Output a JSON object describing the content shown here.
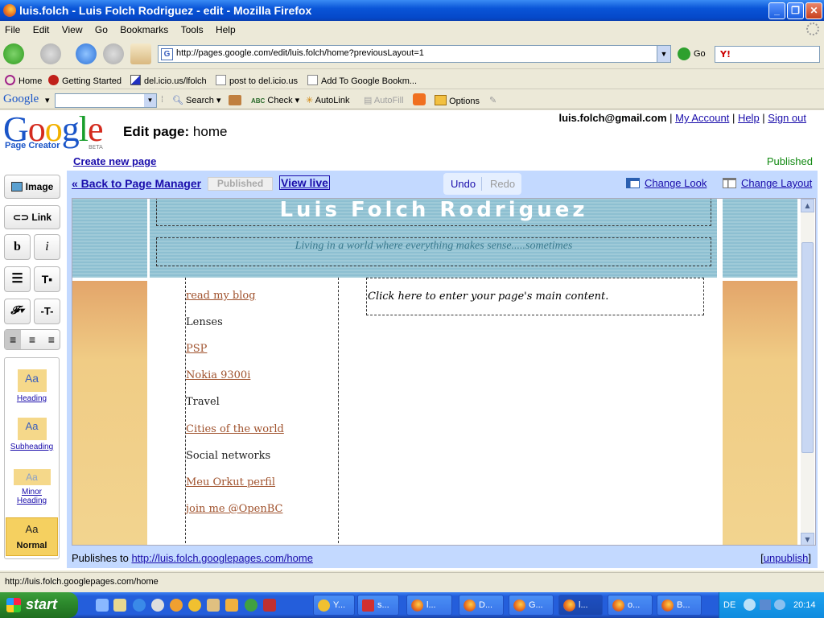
{
  "window": {
    "title": "luis.folch - Luis Folch Rodriguez - edit - Mozilla Firefox"
  },
  "menu": [
    "File",
    "Edit",
    "View",
    "Go",
    "Bookmarks",
    "Tools",
    "Help"
  ],
  "nav": {
    "url": "http://pages.google.com/edit/luis.folch/home?previousLayout=1",
    "go_label": "Go"
  },
  "bookmarks": [
    "Home",
    "Getting Started",
    "del.icio.us/lfolch",
    "post to del.icio.us",
    "Add To Google Bookm..."
  ],
  "gtoolbar": {
    "logo": "Google",
    "search": "Search",
    "check": "Check",
    "autolink": "AutoLink",
    "autofill": "AutoFill",
    "options": "Options"
  },
  "pc": {
    "logo": "Google",
    "logo_sub": "Page Creator",
    "logo_beta": "BETA",
    "edit_label": "Edit page:",
    "page_name": "home",
    "email": "luis.folch@gmail.com",
    "links": [
      "My Account",
      "Help",
      "Sign out"
    ],
    "create_new": "Create new page",
    "status": "Published",
    "back": "« Back to Page Manager",
    "published_btn": "Published",
    "view_live": "View live",
    "undo": "Undo",
    "redo": "Redo",
    "change_look": "Change Look",
    "change_layout": "Change Layout",
    "tools": {
      "image": "Image",
      "link": "Link",
      "bold": "b",
      "italic": "i"
    },
    "styles": [
      {
        "sample": "Aa",
        "label": "Heading"
      },
      {
        "sample": "Aa",
        "label": "Subheading"
      },
      {
        "sample": "Aa",
        "label": "Minor Heading"
      },
      {
        "sample": "Aa",
        "label": "Normal"
      }
    ],
    "site_title": "Luis Folch Rodriguez",
    "site_subtitle": "Living in a world where everything makes sense.....sometimes",
    "nav_items": [
      {
        "text": "read my blog",
        "link": true
      },
      {
        "text": "Lenses",
        "link": false
      },
      {
        "text": "PSP",
        "link": true
      },
      {
        "text": "Nokia 9300i",
        "link": true
      },
      {
        "text": "Travel",
        "link": false
      },
      {
        "text": "Cities of the world",
        "link": true
      },
      {
        "text": "Social networks",
        "link": false
      },
      {
        "text": "Meu Orkut perfil",
        "link": true
      },
      {
        "text": "join me @OpenBC",
        "link": true
      }
    ],
    "main_placeholder": "Click here to enter your page's main content.",
    "publishes_to": "Publishes to",
    "publish_url": "http://luis.folch.googlepages.com/home",
    "unpublish": "unpublish"
  },
  "statusbar": "http://luis.folch.googlepages.com/home",
  "taskbar": {
    "start": "start",
    "items": [
      "Y...",
      "s...",
      "l...",
      "D...",
      "G...",
      "l...",
      "o...",
      "B..."
    ],
    "lang": "DE",
    "time": "20:14"
  }
}
